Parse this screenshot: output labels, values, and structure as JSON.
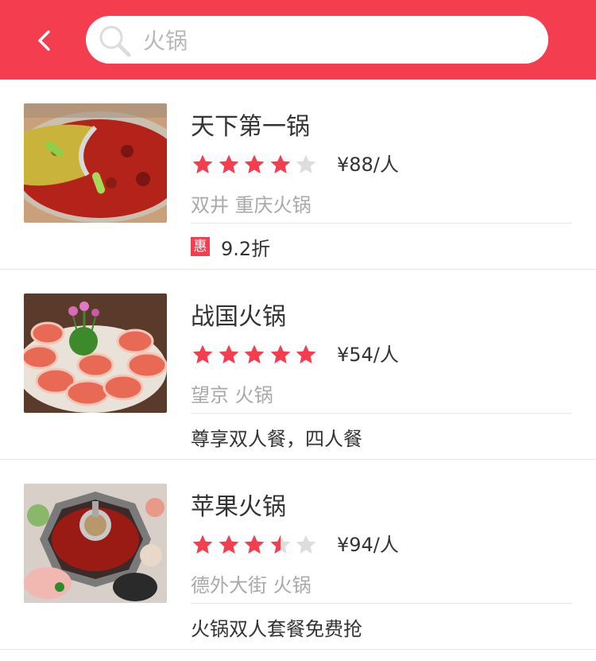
{
  "theme": {
    "brand": "#f53d50",
    "star_on": "#f53d50",
    "star_off": "#dddddd"
  },
  "header": {
    "back_icon": "chevron-left-icon",
    "search": {
      "icon": "search-icon",
      "value": "火锅"
    }
  },
  "items": [
    {
      "name": "天下第一锅",
      "rating": 4,
      "price": "¥88/人",
      "meta": "双井 重庆火锅",
      "promo_badge": "惠",
      "promo_text": "9.2折"
    },
    {
      "name": "战国火锅",
      "rating": 5,
      "price": "¥54/人",
      "meta": "望京 火锅",
      "promo_badge": "",
      "promo_text": "尊享双人餐，四人餐"
    },
    {
      "name": "苹果火锅",
      "rating": 3.5,
      "price": "¥94/人",
      "meta": "德外大街 火锅",
      "promo_badge": "",
      "promo_text": "火锅双人套餐免费抢"
    }
  ]
}
